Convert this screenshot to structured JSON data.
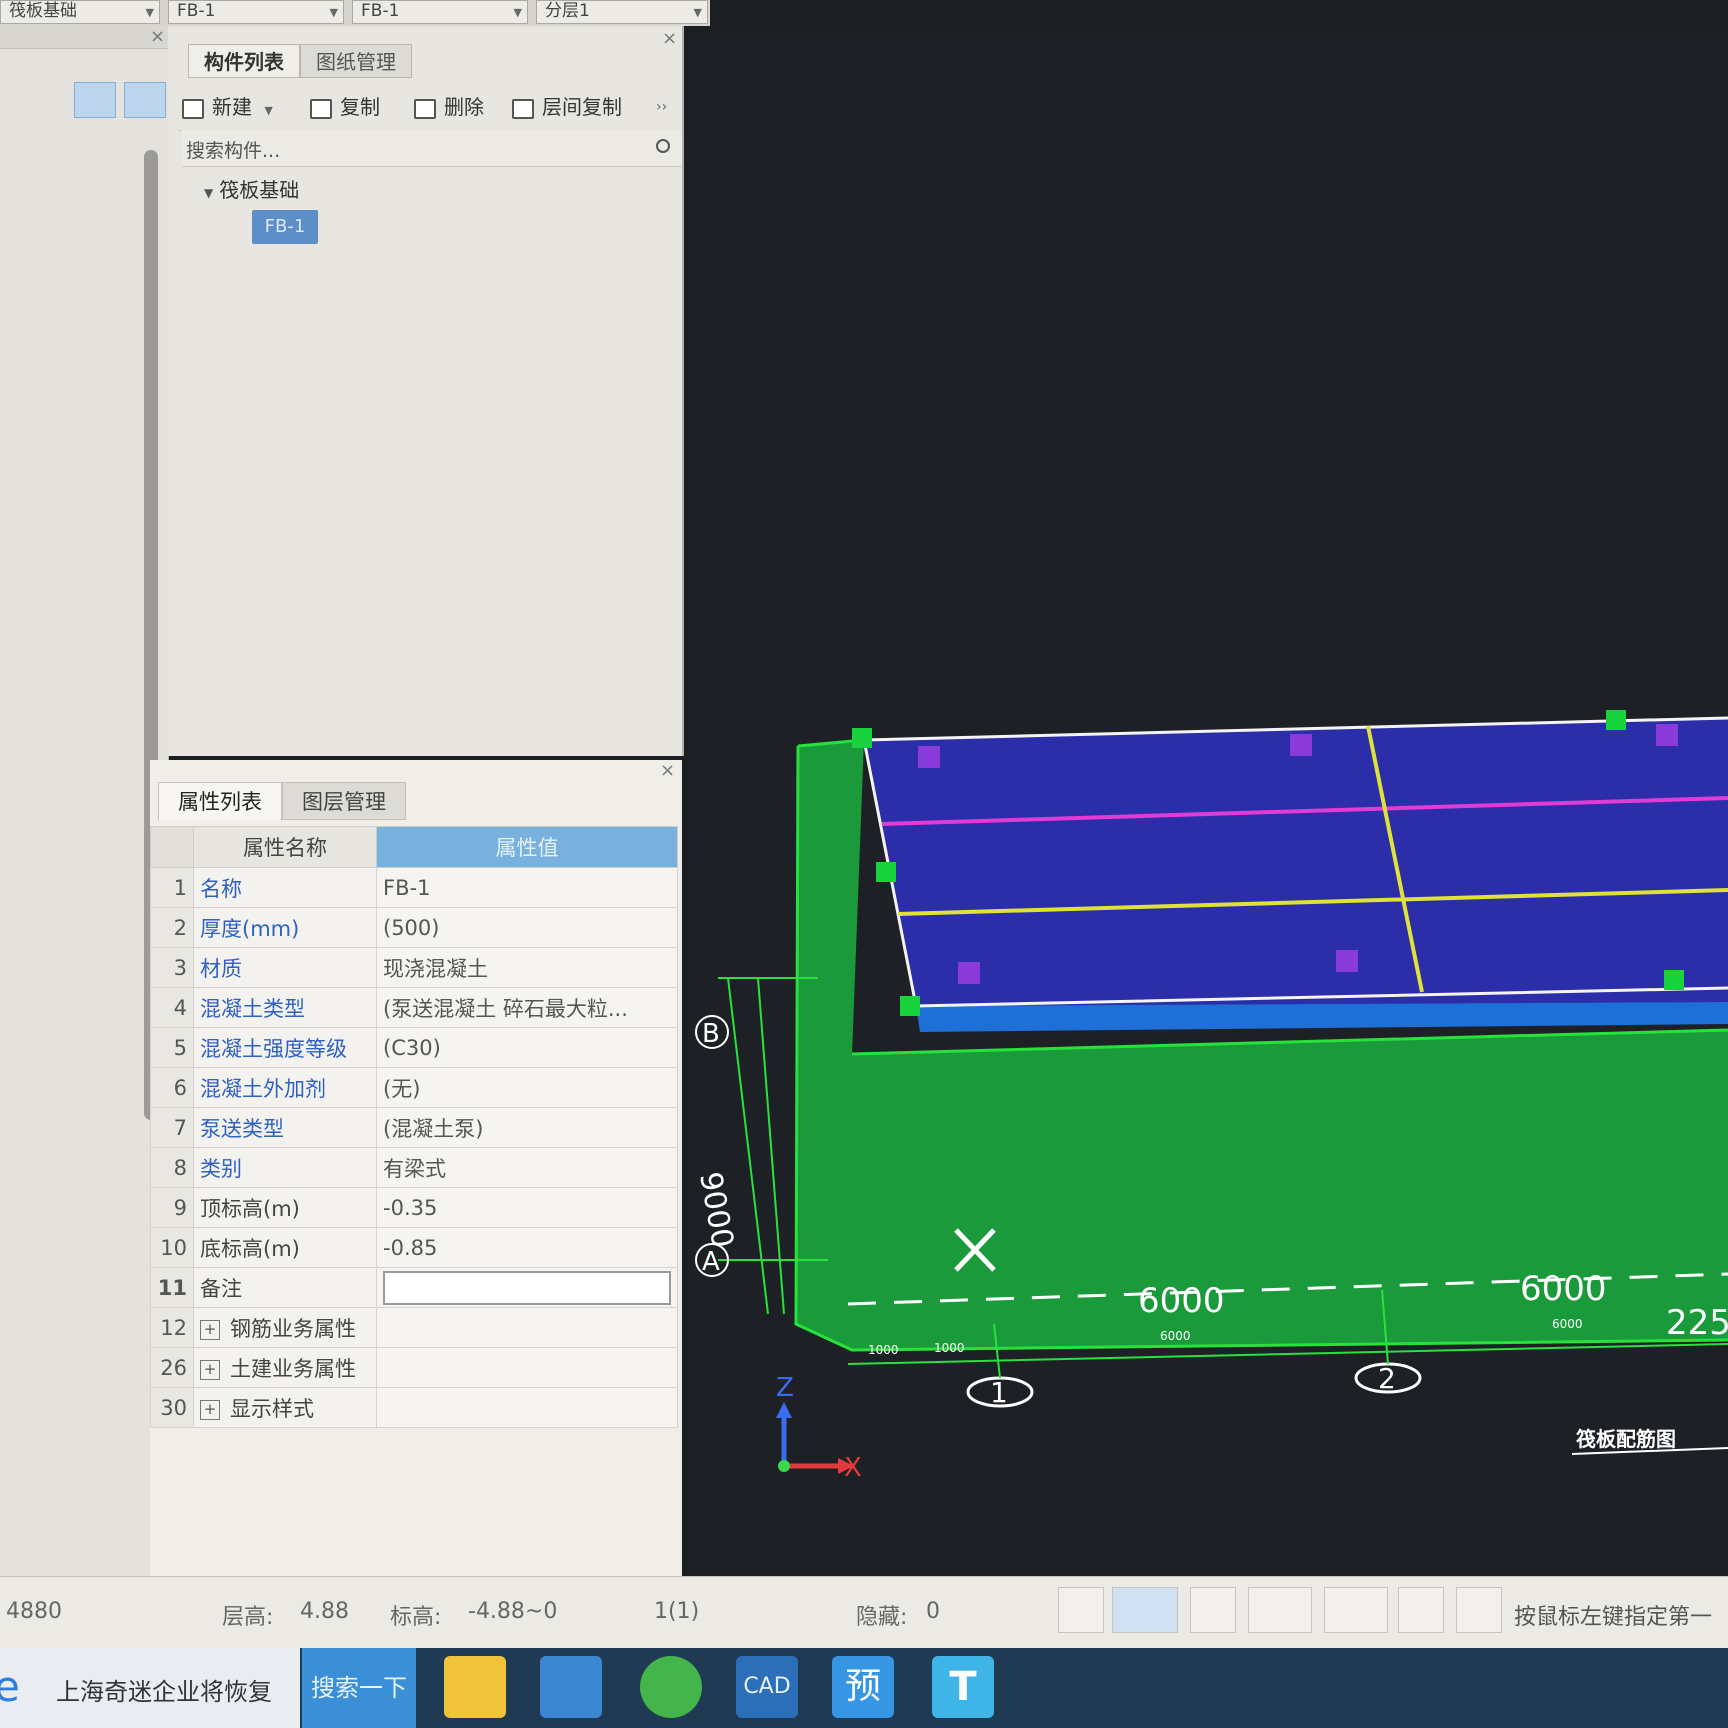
{
  "topbar": {
    "combo1": "筏板基础",
    "combo2": "FB-1",
    "combo3": "分层1"
  },
  "component_panel": {
    "tabs": [
      "构件列表",
      "图纸管理"
    ],
    "toolbar": {
      "new_label": "新建",
      "copy_label": "复制",
      "delete_label": "删除",
      "floor_copy_label": "层间复制"
    },
    "search_placeholder": "搜索构件...",
    "tree": {
      "category": "筏板基础",
      "selected_item": "FB-1"
    }
  },
  "property_panel": {
    "tabs": [
      "属性列表",
      "图层管理"
    ],
    "columns": [
      "属性名称",
      "属性值"
    ],
    "rows": [
      {
        "num": "1",
        "name": "名称",
        "value": "FB-1",
        "linked": true
      },
      {
        "num": "2",
        "name": "厚度(mm)",
        "value": "(500)",
        "linked": true
      },
      {
        "num": "3",
        "name": "材质",
        "value": "现浇混凝土",
        "linked": true
      },
      {
        "num": "4",
        "name": "混凝土类型",
        "value": "(泵送混凝土 碎石最大粒...",
        "linked": true
      },
      {
        "num": "5",
        "name": "混凝土强度等级",
        "value": "(C30)",
        "linked": true
      },
      {
        "num": "6",
        "name": "混凝土外加剂",
        "value": "(无)",
        "linked": true
      },
      {
        "num": "7",
        "name": "泵送类型",
        "value": "(混凝土泵)",
        "linked": true
      },
      {
        "num": "8",
        "name": "类别",
        "value": "有梁式",
        "linked": true
      },
      {
        "num": "9",
        "name": "顶标高(m)",
        "value": "-0.35",
        "linked": false
      },
      {
        "num": "10",
        "name": "底标高(m)",
        "value": "-0.85",
        "linked": false
      },
      {
        "num": "11",
        "name": "备注",
        "value": "",
        "linked": false
      },
      {
        "num": "12",
        "name": "钢筋业务属性",
        "value": "",
        "linked": false
      },
      {
        "num": "26",
        "name": "土建业务属性",
        "value": "",
        "linked": false
      },
      {
        "num": "30",
        "name": "显示样式",
        "value": "",
        "linked": false
      }
    ]
  },
  "viewport": {
    "dim_labels": [
      "6000",
      "6000",
      "225",
      "9000"
    ],
    "small_dims": [
      "1000",
      "1000",
      "6000",
      "6000"
    ],
    "axis_bubbles": [
      "1",
      "2"
    ],
    "row_labels": [
      "B",
      "A"
    ],
    "axis_letters": {
      "z": "Z",
      "x": "X"
    },
    "drawing_title": "筏板配筋图",
    "colors": {
      "slab_top": "#2b2ea8",
      "slab_side": "#1a9a3a",
      "edge_line": "#27e23b",
      "magenta_line": "#e23cd6",
      "yellow_line": "#e0e23a",
      "grip_green": "#19d33c",
      "grip_purple": "#8a3ad8"
    }
  },
  "statusbar": {
    "coord": "4880",
    "floor_height_label": "层高:",
    "floor_height": "4.88",
    "elevation_label": "标高:",
    "elevation": "-4.88~0",
    "count": "1(1)",
    "hidden_label": "隐藏:",
    "hidden": "0",
    "hint": "按鼠标左键指定第一"
  },
  "taskbar": {
    "news_text": "上海奇迷企业将恢复",
    "search_label": "搜索一下",
    "apps": [
      "file-explorer",
      "calculator",
      "browser",
      "cad",
      "preview",
      "t-app"
    ],
    "app_labels": {
      "preview": "预",
      "t_app": "T",
      "cad": "CAD"
    }
  }
}
